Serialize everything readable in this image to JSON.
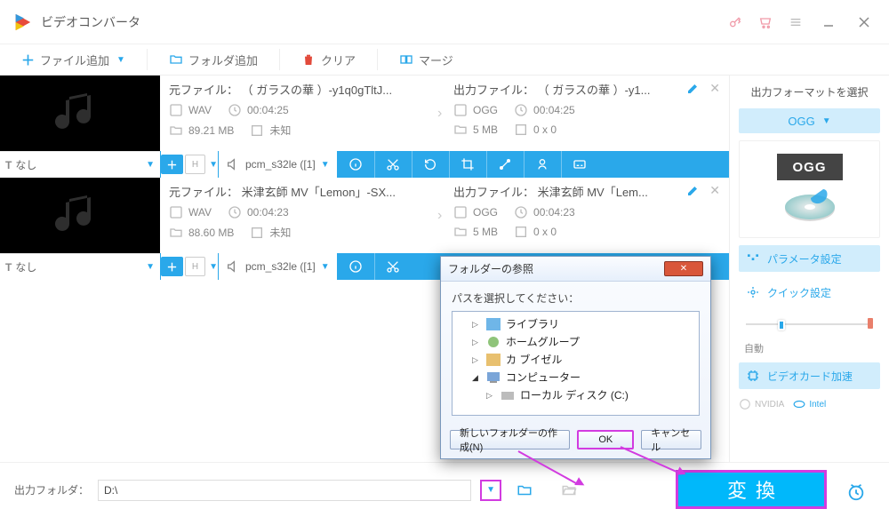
{
  "app": {
    "title": "ビデオコンバータ"
  },
  "toolbar": {
    "add_file": "ファイル追加",
    "add_folder": "フォルダ追加",
    "clear": "クリア",
    "merge": "マージ"
  },
  "files": [
    {
      "source": {
        "label": "元ファイル： （ ガラスの華 ）-y1q0gTltJ...",
        "format": "WAV",
        "duration": "00:04:25",
        "size": "89.21 MB",
        "dimension": "未知"
      },
      "output": {
        "label": "出力ファイル： （ ガラスの華 ）-y1...",
        "format": "OGG",
        "duration": "00:04:25",
        "size": "5 MB",
        "dimension": "0 x 0"
      },
      "subtitle": "なし",
      "codec": "pcm_s32le ([1]"
    },
    {
      "source": {
        "label": "元ファイル： 米津玄師  MV「Lemon」-SX...",
        "format": "WAV",
        "duration": "00:04:23",
        "size": "88.60 MB",
        "dimension": "未知"
      },
      "output": {
        "label": "出力ファイル： 米津玄師  MV「Lem...",
        "format": "OGG",
        "duration": "00:04:23",
        "size": "5 MB",
        "dimension": "0 x 0"
      },
      "subtitle": "なし",
      "codec": "pcm_s32le ([1]"
    }
  ],
  "right": {
    "title": "出力フォーマットを選択",
    "format": "OGG",
    "badge": "OGG",
    "params": "パラメータ設定",
    "quick": "クイック設定",
    "slider_label": "自動",
    "gpu": "ビデオカード加速",
    "nvidia": "NVIDIA",
    "intel": "Intel"
  },
  "bottom": {
    "label": "出力フォルダ：",
    "path": "D:\\",
    "convert": "変換"
  },
  "dialog": {
    "title": "フォルダーの参照",
    "prompt": "パスを選択してください：",
    "nodes": [
      {
        "label": "ライブラリ",
        "indent": 1
      },
      {
        "label": "ホームグループ",
        "indent": 1
      },
      {
        "label": "カ  ブイゼル",
        "indent": 1
      },
      {
        "label": "コンピューター",
        "indent": 1
      },
      {
        "label": "ローカル ディスク (C:)",
        "indent": 2
      }
    ],
    "new_folder": "新しいフォルダーの作成(N)",
    "ok": "OK",
    "cancel": "キャンセル"
  }
}
